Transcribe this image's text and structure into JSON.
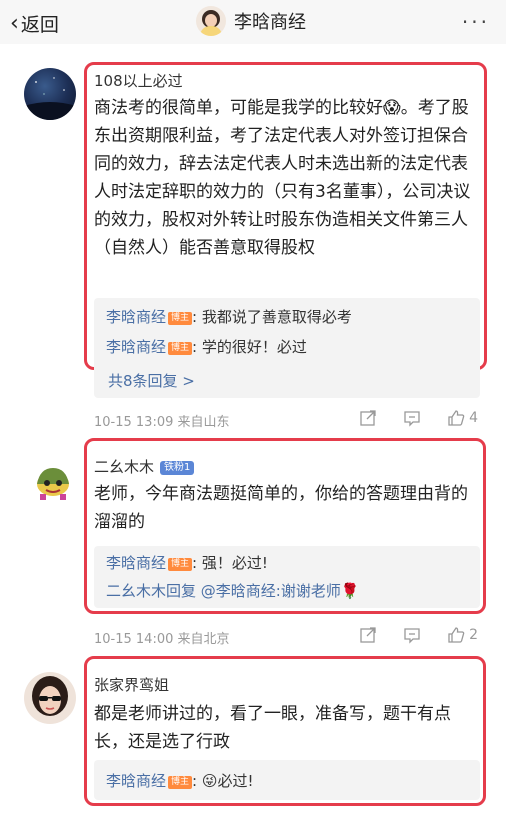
{
  "header": {
    "back_label": "返回",
    "title": "李晗商经",
    "more": "···"
  },
  "comments": [
    {
      "username": "108以上必过",
      "body": "商法考的很简单，可能是我学的比较好😱。考了股东出资期限利益，考了法定代表人对外签订担保合同的效力，辞去法定代表人时未选出新的法定代表人时法定辞职的效力的（只有3名董事），公司决议的效力，股权对外转让时股东伪造相关文件第三人（自然人）能否善意取得股权",
      "replies": [
        {
          "name": "李晗商经",
          "badge": "博主",
          "text": ": 我都说了善意取得必考"
        },
        {
          "name": "李晗商经",
          "badge": "博主",
          "text": ": 学的很好！必过"
        }
      ],
      "more_replies": "共8条回复 >",
      "meta": "10-15 13:09 来自山东",
      "likes": "4"
    },
    {
      "username": "二幺木木",
      "fan_badge": "铁粉1",
      "body": "老师，今年商法题挺简单的，你给的答题理由背的溜溜的",
      "replies": [
        {
          "name": "李晗商经",
          "badge": "博主",
          "text": ": 强！必过!"
        },
        {
          "name": "二幺木木",
          "badge": "",
          "text": "回复 @李晗商经:谢谢老师🌹"
        }
      ],
      "meta": "10-15 14:00 来自北京",
      "likes": "2"
    },
    {
      "username": "张家界鸾姐",
      "body": "都是老师讲过的，看了一眼，准备写，题干有点长，还是选了行政",
      "replies": [
        {
          "name": "李晗商经",
          "badge": "博主",
          "text": ": 😜必过!"
        }
      ]
    }
  ],
  "colors": {
    "highlight_border": "#e53c4b",
    "link_blue": "#4a6fa5",
    "badge_orange": "#ff8a3d"
  }
}
